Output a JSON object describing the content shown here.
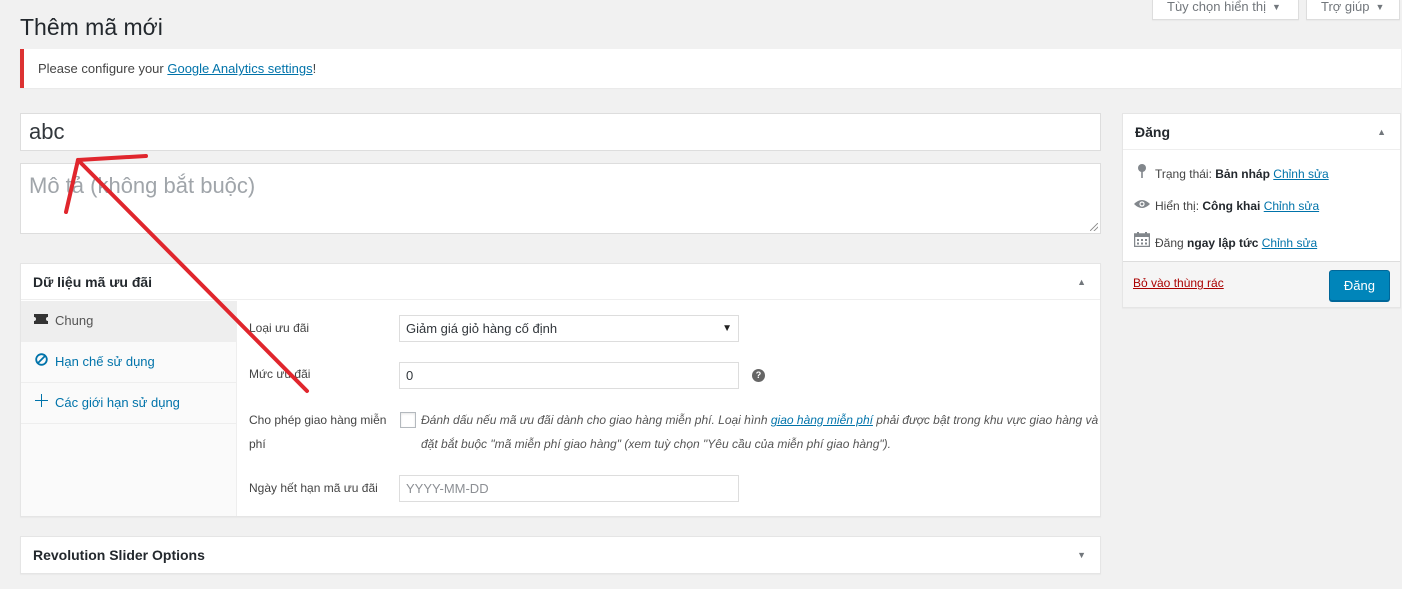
{
  "screen_options": {
    "label": "Tùy chọn hiển thị",
    "arrow": "▼"
  },
  "help_tab": {
    "label": "Trợ giúp",
    "arrow": "▼"
  },
  "page_title": "Thêm mã mới",
  "notice": {
    "prefix": "Please configure your ",
    "link": "Google Analytics settings",
    "suffix": "!",
    "border_color": "#dc3232"
  },
  "title_input": {
    "value": "abc"
  },
  "description": {
    "placeholder": "Mô tả (không bắt buộc)"
  },
  "coupon_data": {
    "title": "Dữ liệu mã ưu đãi",
    "tabs": [
      {
        "label": "Chung",
        "icon": "ticket-icon"
      },
      {
        "label": "Hạn chế sử dụng",
        "icon": "block-icon"
      },
      {
        "label": "Các giới hạn sử dụng",
        "icon": "plus-icon"
      }
    ],
    "fields": {
      "discount_type": {
        "label": "Loại ưu đãi",
        "value": "Giảm giá giỏ hàng cố định"
      },
      "amount": {
        "label": "Mức ưu đãi",
        "value": "0"
      },
      "free_shipping": {
        "label": "Cho phép giao hàng miễn phí",
        "desc_before": "Đánh dấu nếu mã ưu đãi dành cho giao hàng miễn phí. Loại hình ",
        "desc_link": "giao hàng miễn phí",
        "desc_after": " phải được bật trong khu vực giao hàng và đặt bắt buộc \"mã miễn phí giao hàng\" (xem tuỳ chọn \"Yêu cầu của miễn phí giao hàng\")."
      },
      "expiry": {
        "label": "Ngày hết hạn mã ưu đãi",
        "placeholder": "YYYY-MM-DD"
      }
    }
  },
  "revslider": {
    "title": "Revolution Slider Options"
  },
  "publish": {
    "title": "Đăng",
    "status_label": "Trạng thái: ",
    "status_value": "Bản nháp",
    "visibility_label": "Hiển thị: ",
    "visibility_value": "Công khai",
    "schedule_label": "Đăng ",
    "schedule_value": "ngay lập tức",
    "edit_link": "Chỉnh sửa",
    "trash": "Bỏ vào thùng rác",
    "publish_button": "Đăng",
    "button_color": "#0085ba"
  },
  "annotation_color": "#e0262d"
}
